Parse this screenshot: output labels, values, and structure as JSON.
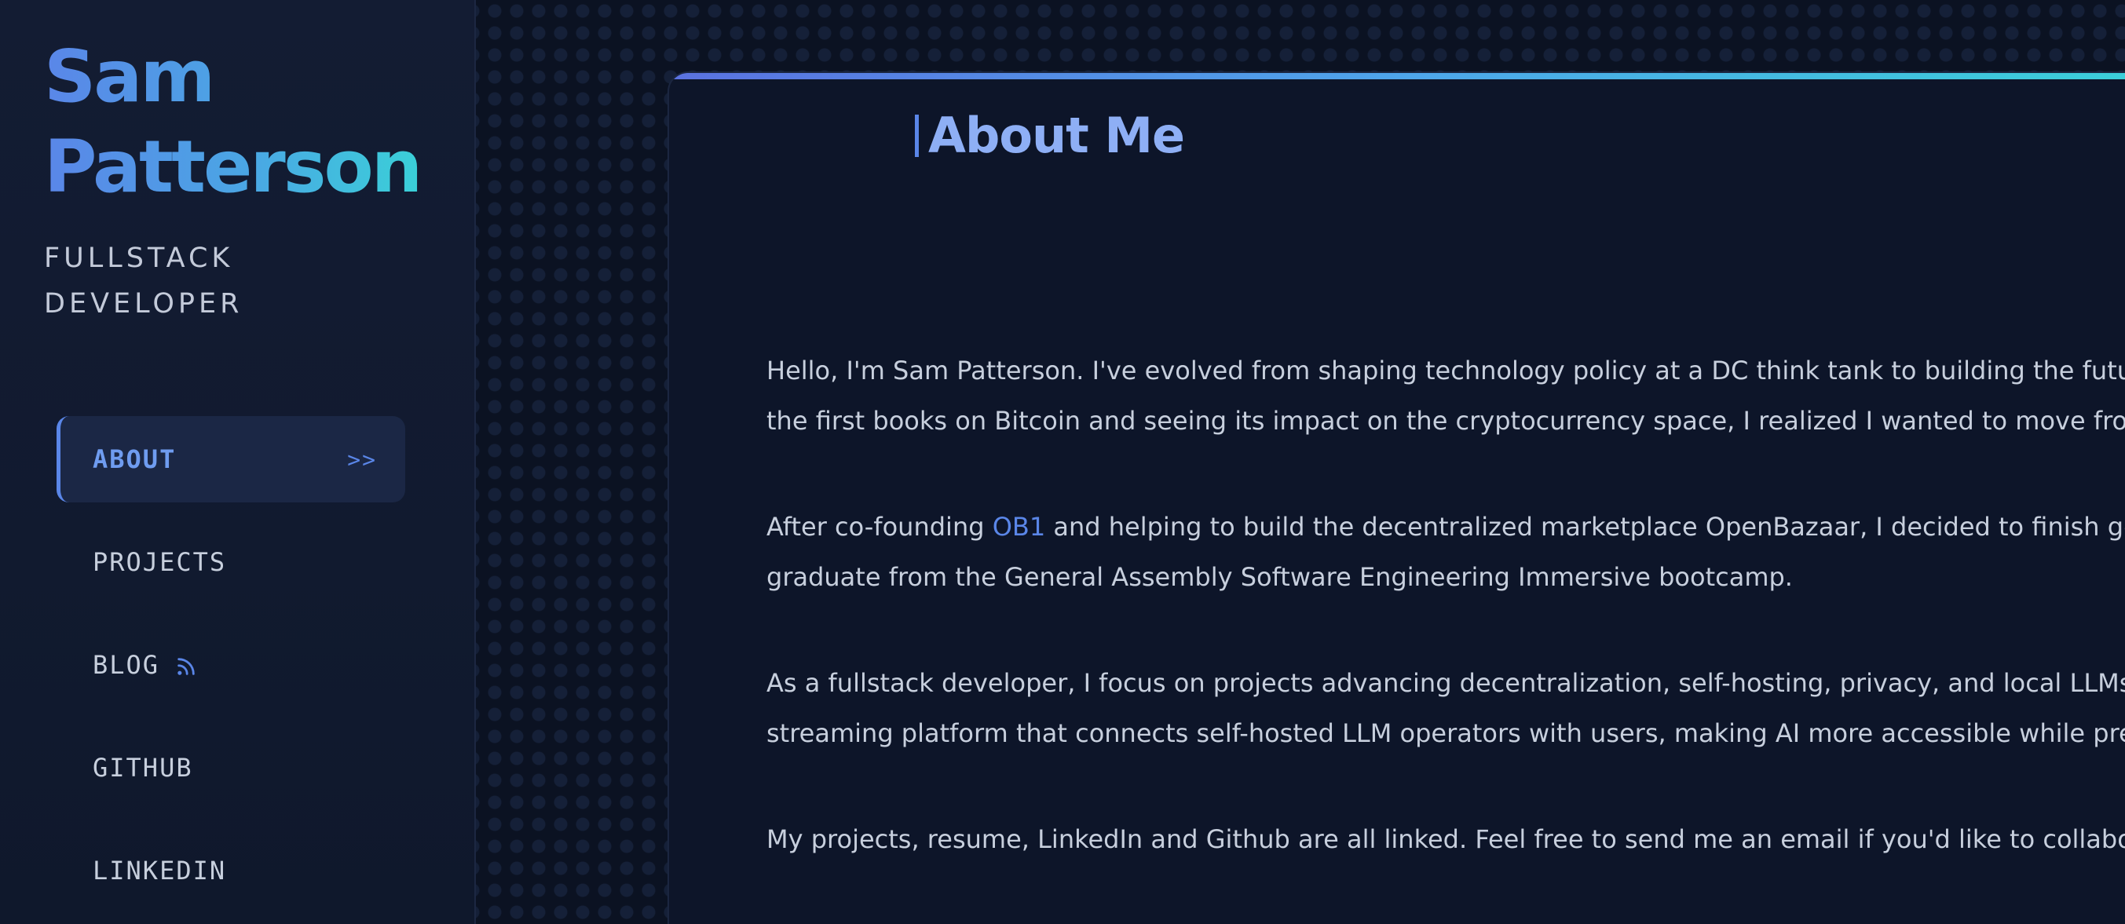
{
  "sidebar": {
    "name_line1": "Sam",
    "name_line2": "Patterson",
    "role_line1": "FULLSTACK",
    "role_line2": "DEVELOPER",
    "nav": [
      {
        "label": "ABOUT",
        "active": true,
        "arrow": ">>"
      },
      {
        "label": "PROJECTS"
      },
      {
        "label": "BLOG",
        "icon": "rss-icon"
      },
      {
        "label": "GITHUB"
      },
      {
        "label": "LINKEDIN"
      }
    ]
  },
  "main": {
    "title": "About Me",
    "p1": {
      "line1": "Hello, I'm Sam Patterson. I've evolved from shaping technology policy at a DC think tank to building the future I",
      "line2": "the first books on Bitcoin and seeing its impact on the cryptocurrency space, I realized I wanted to move from ar"
    },
    "p2": {
      "before": "After co-founding ",
      "link": "OB1",
      "after": " and helping to build the decentralized marketplace OpenBazaar, I decided to finish getti",
      "line2": "graduate from the General Assembly Software Engineering Immersive bootcamp."
    },
    "p3": {
      "line1": "As a fullstack developer, I focus on projects advancing decentralization, self-hosting, privacy, and local LLMs. I'",
      "line2": "streaming platform that connects self-hosted LLM operators with users, making AI more accessible while prese"
    },
    "p4": {
      "line1": "My projects, resume, LinkedIn and Github are all linked. Feel free to send me an email if you'd like to collaborate"
    }
  },
  "colors": {
    "accent": "#5a86e8",
    "accent_cyan": "#3ad0d8",
    "background": "#0b1222",
    "sidebar": "#131c33",
    "text": "#c7cfdd"
  }
}
